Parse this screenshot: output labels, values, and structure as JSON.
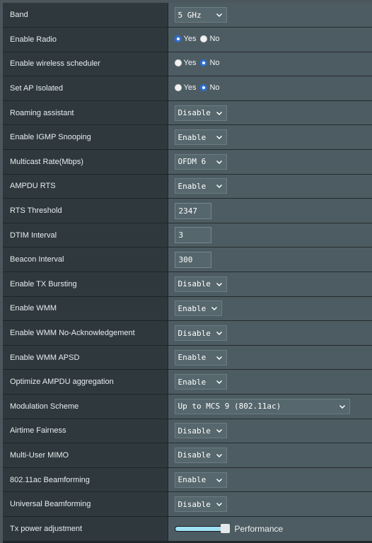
{
  "settings": {
    "rows": [
      {
        "label": "Band",
        "type": "select",
        "value": "5 GHz",
        "width": "w72"
      },
      {
        "label": "Enable Radio",
        "type": "radio",
        "options": [
          "Yes",
          "No"
        ],
        "selected": "Yes"
      },
      {
        "label": "Enable wireless scheduler",
        "type": "radio",
        "options": [
          "Yes",
          "No"
        ],
        "selected": "No"
      },
      {
        "label": "Set AP Isolated",
        "type": "radio",
        "options": [
          "Yes",
          "No"
        ],
        "selected": "No"
      },
      {
        "label": "Roaming assistant",
        "type": "select",
        "value": "Disable",
        "width": "w72"
      },
      {
        "label": "Enable IGMP Snooping",
        "type": "select",
        "value": "Enable",
        "width": "w72"
      },
      {
        "label": "Multicast Rate(Mbps)",
        "type": "select",
        "value": "OFDM 6",
        "width": "w72"
      },
      {
        "label": "AMPDU RTS",
        "type": "select",
        "value": "Enable",
        "width": "w72"
      },
      {
        "label": "RTS Threshold",
        "type": "text",
        "value": "2347"
      },
      {
        "label": "DTIM Interval",
        "type": "text",
        "value": "3"
      },
      {
        "label": "Beacon Interval",
        "type": "text",
        "value": "300"
      },
      {
        "label": "Enable TX Bursting",
        "type": "select",
        "value": "Disable",
        "width": "w72"
      },
      {
        "label": "Enable WMM",
        "type": "select",
        "value": "Enable",
        "width": "w66"
      },
      {
        "label": "Enable WMM No-Acknowledgement",
        "type": "select",
        "value": "Disable",
        "width": "w72"
      },
      {
        "label": "Enable WMM APSD",
        "type": "select",
        "value": "Enable",
        "width": "w72"
      },
      {
        "label": "Optimize AMPDU aggregation",
        "type": "select",
        "value": "Enable",
        "width": "w72"
      },
      {
        "label": "Modulation Scheme",
        "type": "select",
        "value": "Up to MCS 9 (802.11ac)",
        "width": "wide"
      },
      {
        "label": "Airtime Fairness",
        "type": "select",
        "value": "Disable",
        "width": "w72"
      },
      {
        "label": "Multi-User MIMO",
        "type": "select",
        "value": "Disable",
        "width": "w72"
      },
      {
        "label": "802.11ac Beamforming",
        "type": "select",
        "value": "Enable",
        "width": "w72"
      },
      {
        "label": "Universal Beamforming",
        "type": "select",
        "value": "Disable",
        "width": "w72"
      },
      {
        "label": "Tx power adjustment",
        "type": "slider",
        "value_fraction": 1.0,
        "value_label": "Performance"
      }
    ]
  },
  "colors": {
    "radio_selected": "#2a6fd6",
    "slider_fill": "#9fe2f5"
  },
  "icons": {
    "dropdown": "chevron-down-icon"
  }
}
